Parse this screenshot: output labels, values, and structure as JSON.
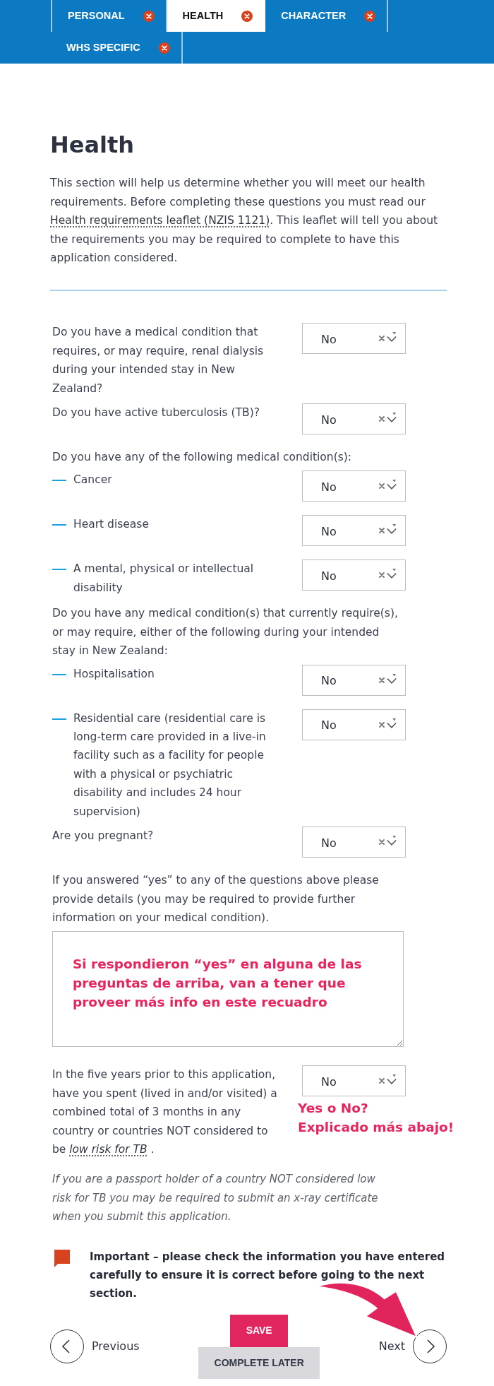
{
  "tabs": [
    {
      "label": "PERSONAL",
      "selected": false
    },
    {
      "label": "HEALTH",
      "selected": true
    },
    {
      "label": "CHARACTER",
      "selected": false
    },
    {
      "label": "WHS SPECIFIC",
      "selected": false
    }
  ],
  "heading": "Health",
  "intro": {
    "text": "This section will help us determine whether you will meet our health requirements. Before completing these questions you must read our ",
    "link": "Health requirements leaflet (NZIS 1121)",
    "after": ". This leaflet will tell you about the requirements you may be required to complete to have this application considered."
  },
  "questions": [
    {
      "kind": "question",
      "text": "Do you have a medical condition that requires, or may require, renal dialysis during your intended stay in New Zealand?",
      "answer": "No"
    },
    {
      "kind": "question",
      "text": "Do you have active tuberculosis (TB)?",
      "answer": "No"
    },
    {
      "kind": "heading",
      "text": "Do you have any of the following medical condition(s):"
    },
    {
      "kind": "sub_question",
      "text": "Cancer",
      "answer": "No"
    },
    {
      "kind": "sub_question",
      "text": "Heart disease",
      "answer": "No"
    },
    {
      "kind": "sub_question",
      "text": "A mental, physical or intellectual disability",
      "answer": "No"
    },
    {
      "kind": "heading",
      "text": "Do you have any medical condition(s) that currently require(s), or may require, either of the following during your intended stay in New Zealand:"
    },
    {
      "kind": "sub_question",
      "text": "Hospitalisation",
      "answer": "No"
    },
    {
      "kind": "sub_question",
      "text": "Residential care (residential care is long-term care provided in a live-in facility such as a facility for people with a physical or psychiatric disability and includes 24 hour supervision)",
      "answer": "No"
    },
    {
      "kind": "question",
      "text": "Are you pregnant?",
      "answer": "No"
    },
    {
      "kind": "heading",
      "text": "If you answered “yes” to any of the questions above please provide details (you may be required to provide further information on your medical condition)."
    },
    {
      "kind": "details",
      "annotation": "Si respondieron “yes” en alguna de las preguntas de arriba, van a tener que proveer más info en este recuadro"
    },
    {
      "kind": "question",
      "text": "In the five years prior to this application, have you spent (lived in and/or visited) a combined total of 3 months in any country or countries NOT considered to be ",
      "link": "low risk for TB",
      "after": " .",
      "answer": "No",
      "annotation": "Yes o No?\nExplicado más abajo!"
    }
  ],
  "note": "If you are a passport holder of a country NOT considered low risk for TB you may be required to submit an x-ray certificate when you submit this application.",
  "important": "Important – please check the information you have entered carefully to ensure it is correct before going to the next section.",
  "navigation": {
    "previous": "Previous",
    "save": "SAVE",
    "complete_later": "COMPLETE LATER",
    "next": "Next"
  }
}
